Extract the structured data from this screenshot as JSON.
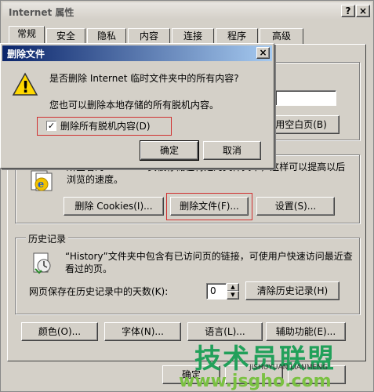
{
  "window": {
    "title": "Internet 属性",
    "help_btn": "?",
    "close_btn": "×"
  },
  "tabs": [
    {
      "label": "常规",
      "active": true
    },
    {
      "label": "安全"
    },
    {
      "label": "隐私"
    },
    {
      "label": "内容"
    },
    {
      "label": "连接"
    },
    {
      "label": "程序"
    },
    {
      "label": "高级"
    }
  ],
  "homepage": {
    "blank_btn": "使用空白页(B)"
  },
  "temp_files": {
    "description": "所查看的 Internet 页被存储在特定的文件夹中，这样可以提高以后浏览的速度。",
    "delete_cookies_btn": "删除 Cookies(I)...",
    "delete_files_btn": "删除文件(F)...",
    "settings_btn": "设置(S)..."
  },
  "history": {
    "group_label": "历史记录",
    "description": "“History”文件夹中包含有已访问页的链接，可使用户快速访问最近查看过的页。",
    "days_label": "网页保存在历史记录中的天数(K):",
    "days_value": "0",
    "clear_btn": "清除历史记录(H)"
  },
  "bottom_buttons": {
    "colors": "颜色(O)...",
    "fonts": "字体(N)...",
    "languages": "语言(L)...",
    "accessibility": "辅助功能(E)..."
  },
  "footer": {
    "ok": "确定"
  },
  "dialog": {
    "title": "删除文件",
    "close_btn": "×",
    "question": "是否删除 Internet 临时文件夹中的所有内容?",
    "sub_text": "您也可以删除本地存储的所有脱机内容。",
    "checkbox_label": "删除所有脱机内容(D)",
    "checkbox_checked": true,
    "checkbox_mark": "✓",
    "ok": "确定",
    "cancel": "取消",
    "warning_glyph": "!"
  },
  "watermark": {
    "main": "技术员联盟",
    "sub": "www.jsgho.com",
    "small": "JISHUYUAN LIANMENG"
  },
  "colors": {
    "dialog_red_highlight": "#d03030",
    "title_blue": "#0a246a",
    "watermark_green": "#22a05a"
  }
}
